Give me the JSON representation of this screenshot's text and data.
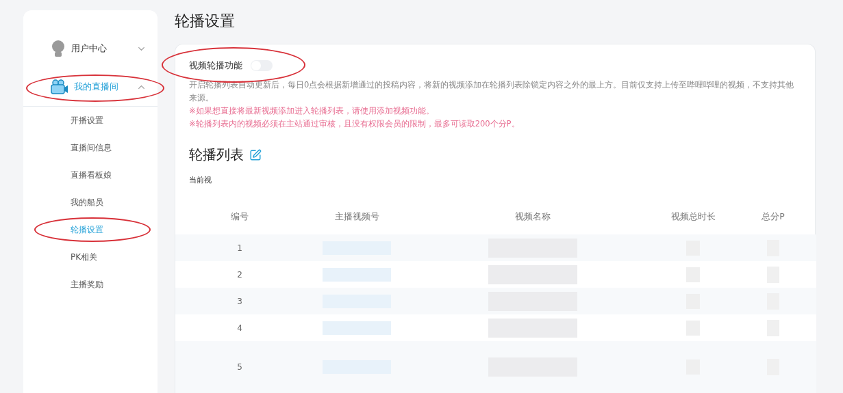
{
  "sidebar": {
    "groups": [
      {
        "label": "用户中心",
        "expanded": false,
        "selected": false,
        "circled": false
      },
      {
        "label": "我的直播间",
        "expanded": true,
        "selected": true,
        "circled": true,
        "children": [
          {
            "label": "开播设置",
            "selected": false,
            "circled": false
          },
          {
            "label": "直播间信息",
            "selected": false,
            "circled": false
          },
          {
            "label": "直播看板娘",
            "selected": false,
            "circled": false
          },
          {
            "label": "我的船员",
            "selected": false,
            "circled": false
          },
          {
            "label": "轮播设置",
            "selected": true,
            "circled": true
          },
          {
            "label": "PK相关",
            "selected": false,
            "circled": false
          },
          {
            "label": "主播奖励",
            "selected": false,
            "circled": false
          }
        ]
      }
    ]
  },
  "page_title": "轮播设置",
  "toggle": {
    "label": "视频轮播功能",
    "on": false,
    "circled": true
  },
  "description": "开启轮播列表自动更新后，每日0点会根据新增通过的投稿内容，将新的视频添加在轮播列表除锁定内容之外的最上方。目前仅支持上传至哔哩哔哩的视频，不支持其他来源。",
  "notes": [
    "※如果想直接将最新视频添加进入轮播列表，请使用添加视频功能。",
    "※轮播列表内的视频必须在主站通过审核，且没有权限会员的限制，最多可读取200个分P。"
  ],
  "list_title": "轮播列表",
  "current_label": "当前视",
  "table": {
    "columns": [
      "编号",
      "主播视频号",
      "视频名称",
      "视频总时长",
      "总分P"
    ],
    "rows": [
      {
        "number": "1"
      },
      {
        "number": "2"
      },
      {
        "number": "3"
      },
      {
        "number": "4"
      },
      {
        "number": "5"
      }
    ]
  }
}
